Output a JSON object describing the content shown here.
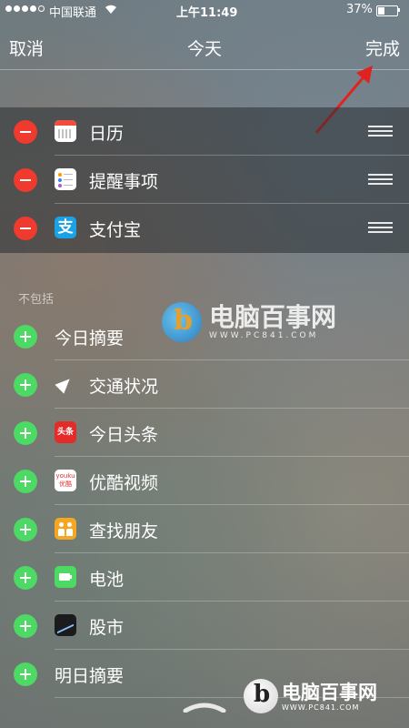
{
  "status_bar": {
    "signal_dots_filled": 4,
    "signal_dots_total": 5,
    "carrier": "中国联通",
    "time": "上午11:49",
    "battery_percent": "37%",
    "battery_level": 0.37
  },
  "nav": {
    "cancel_label": "取消",
    "title": "今天",
    "done_label": "完成"
  },
  "included_section": {
    "items": [
      {
        "label": "日历",
        "icon": "calendar-icon"
      },
      {
        "label": "提醒事项",
        "icon": "reminders-icon"
      },
      {
        "label": "支付宝",
        "icon": "alipay-icon",
        "icon_text": "支"
      }
    ]
  },
  "excluded_section": {
    "header": "不包括",
    "items": [
      {
        "label": "今日摘要",
        "icon": null
      },
      {
        "label": "交通状况",
        "icon": "navigation-arrow-icon"
      },
      {
        "label": "今日头条",
        "icon": "toutiao-icon",
        "icon_text": "头条"
      },
      {
        "label": "优酷视频",
        "icon": "youku-icon",
        "icon_text": "youku 优酷"
      },
      {
        "label": "查找朋友",
        "icon": "find-friends-icon"
      },
      {
        "label": "电池",
        "icon": "battery-icon"
      },
      {
        "label": "股市",
        "icon": "stocks-icon"
      },
      {
        "label": "明日摘要",
        "icon": null
      }
    ]
  },
  "watermark": {
    "name": "电脑百事网",
    "url": "WWW.PC841.COM"
  },
  "watermark_corner": {
    "name": "电脑百事网",
    "url": "WWW.PC841.COM"
  },
  "colors": {
    "delete": "#f03a2e",
    "add": "#4cd964",
    "annotation_arrow": "#e0231f"
  }
}
